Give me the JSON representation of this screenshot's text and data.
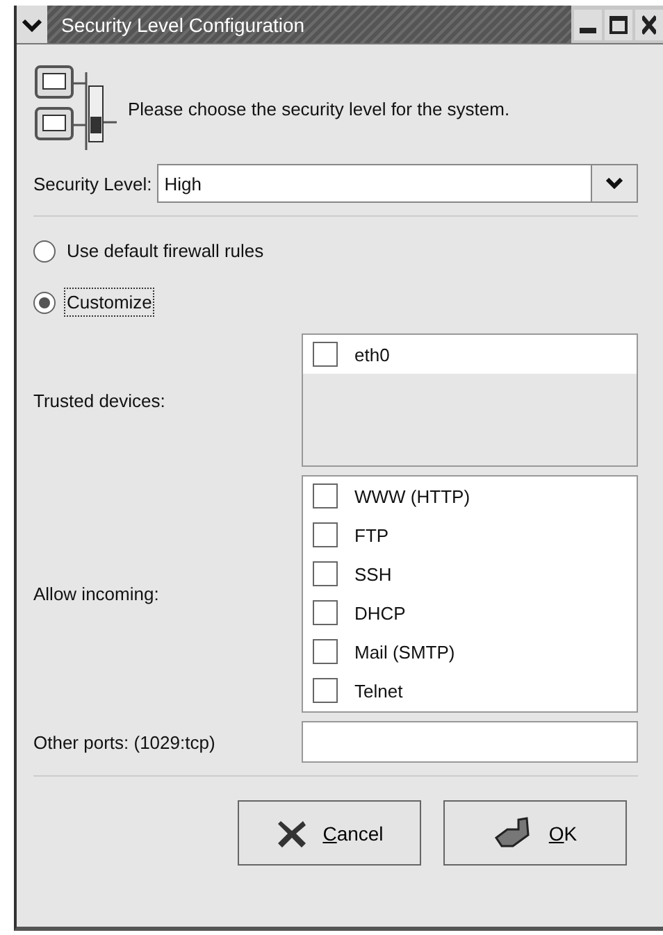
{
  "window": {
    "title": "Security Level Configuration"
  },
  "intro": "Please choose the security level for the system.",
  "security_level": {
    "label": "Security Level:",
    "value": "High"
  },
  "firewall_options": [
    {
      "label": "Use default firewall rules",
      "selected": false
    },
    {
      "label": "Customize",
      "selected": true
    }
  ],
  "trusted_devices": {
    "label": "Trusted devices:",
    "items": [
      {
        "label": "eth0",
        "checked": false
      }
    ]
  },
  "allow_incoming": {
    "label": "Allow incoming:",
    "items": [
      {
        "label": "WWW (HTTP)",
        "checked": false
      },
      {
        "label": "FTP",
        "checked": false
      },
      {
        "label": "SSH",
        "checked": false
      },
      {
        "label": "DHCP",
        "checked": false
      },
      {
        "label": "Mail (SMTP)",
        "checked": false
      },
      {
        "label": "Telnet",
        "checked": false
      }
    ]
  },
  "other_ports": {
    "label": "Other ports: (1029:tcp)"
  },
  "buttons": [
    {
      "kind": "cancel",
      "label": "Cancel"
    },
    {
      "kind": "ok",
      "label": "OK"
    }
  ]
}
